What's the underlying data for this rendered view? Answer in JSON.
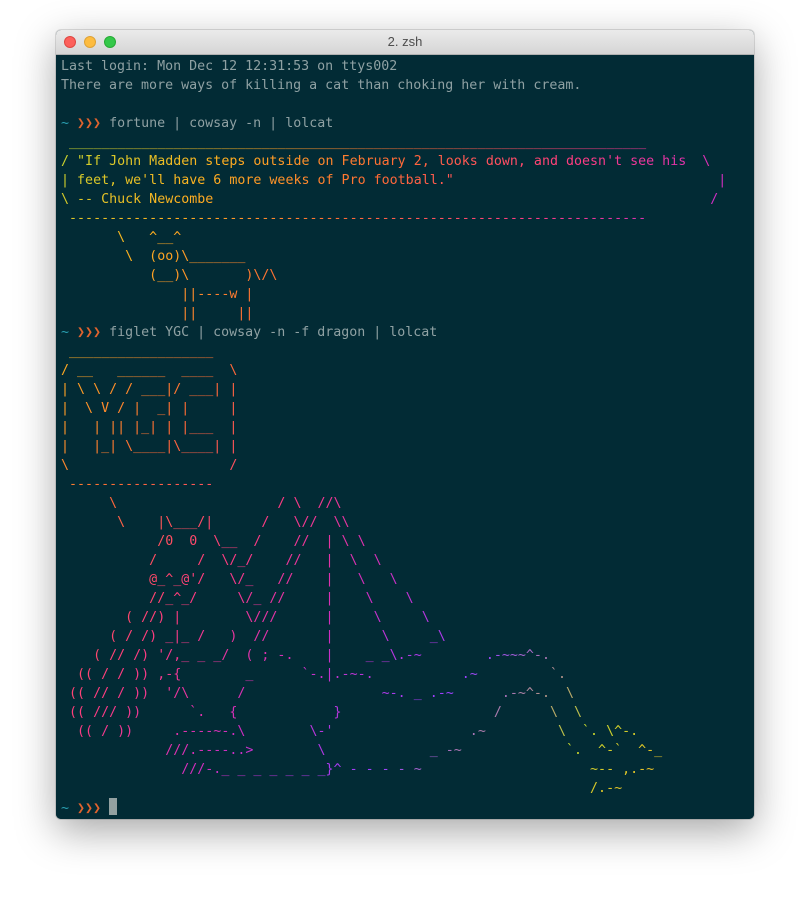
{
  "window": {
    "title": "2. zsh"
  },
  "prompt": {
    "tilde": "~",
    "arrows": "❯❯❯"
  },
  "colors": {
    "background": "#022b35",
    "text": "#8fa1a3",
    "prompt_arrow": "#e0632e",
    "prompt_tilde": "#2aa1b3",
    "lolcat_gradient": [
      "#c5d62e",
      "#ffb020",
      "#ff6b35",
      "#ff3d7f",
      "#d02ec0",
      "#9b40ff"
    ]
  },
  "terminal": {
    "lines": [
      {
        "type": "plain",
        "text": "Last login: Mon Dec 12 12:31:53 on ttys002"
      },
      {
        "type": "plain",
        "text": "There are more ways of killing a cat than choking her with cream."
      },
      {
        "type": "plain",
        "text": ""
      },
      {
        "type": "prompt",
        "text": "fortune | cowsay -n | lolcat"
      },
      {
        "type": "rainbow",
        "text": " ________________________________________________________________________"
      },
      {
        "type": "rainbow",
        "text": "/ \"If John Madden steps outside on February 2, looks down, and doesn't see his  \\"
      },
      {
        "type": "rainbow",
        "text": "| feet, we'll have 6 more weeks of Pro football.\"                                 |"
      },
      {
        "type": "rainbow",
        "text": "\\ -- Chuck Newcombe                                                              /"
      },
      {
        "type": "rainbow",
        "text": " ------------------------------------------------------------------------"
      },
      {
        "type": "rainbow",
        "text": "       \\   ^__^"
      },
      {
        "type": "rainbow",
        "text": "        \\  (oo)\\_______"
      },
      {
        "type": "rainbow",
        "text": "           (__)\\       )\\/\\"
      },
      {
        "type": "rainbow",
        "text": "               ||----w |"
      },
      {
        "type": "rainbow",
        "text": "               ||     ||"
      },
      {
        "type": "prompt",
        "text": "figlet YGC | cowsay -n -f dragon | lolcat"
      },
      {
        "type": "rainbow",
        "text": " __________________"
      },
      {
        "type": "rainbow",
        "text": "/ __   ______  ____  \\"
      },
      {
        "type": "rainbow",
        "text": "| \\ \\ / / ___|/ ___| |"
      },
      {
        "type": "rainbow",
        "text": "|  \\ V / |  _| |     |"
      },
      {
        "type": "rainbow",
        "text": "|   | || |_| | |___  |"
      },
      {
        "type": "rainbow",
        "text": "|   |_| \\____|\\____| |"
      },
      {
        "type": "rainbow",
        "text": "\\                    /"
      },
      {
        "type": "rainbow",
        "text": " ------------------"
      },
      {
        "type": "rainbow",
        "text": "      \\                    / \\  //\\"
      },
      {
        "type": "rainbow",
        "text": "       \\    |\\___/|      /   \\//  \\\\"
      },
      {
        "type": "rainbow",
        "text": "            /0  0  \\__  /    //  | \\ \\"
      },
      {
        "type": "rainbow",
        "text": "           /     /  \\/_/    //   |  \\  \\"
      },
      {
        "type": "rainbow",
        "text": "           @_^_@'/   \\/_   //    |   \\   \\"
      },
      {
        "type": "rainbow",
        "text": "           //_^_/     \\/_ //     |    \\    \\"
      },
      {
        "type": "rainbow",
        "text": "        ( //) |        \\///      |     \\     \\"
      },
      {
        "type": "rainbow",
        "text": "      ( / /) _|_ /   )  //       |      \\     _\\"
      },
      {
        "type": "rainbow",
        "text": "    ( // /) '/,_ _ _/  ( ; -.    |    _ _\\.-~        .-~~~^-."
      },
      {
        "type": "rainbow",
        "text": "  (( / / )) ,-{        _      `-.|.-~-.           .~         `."
      },
      {
        "type": "rainbow",
        "text": " (( // / ))  '/\\      /                 ~-. _ .-~      .-~^-.  \\"
      },
      {
        "type": "rainbow",
        "text": " (( /// ))      `.   {            }                   /      \\  \\"
      },
      {
        "type": "rainbow",
        "text": "  (( / ))     .----~-.\\        \\-'                 .~         \\  `. \\^-."
      },
      {
        "type": "rainbow",
        "text": "             ///.----..>        \\             _ -~             `.  ^-`  ^-_"
      },
      {
        "type": "rainbow",
        "text": "               ///-._ _ _ _ _ _ _}^ - - - - ~                     ~-- ,.-~"
      },
      {
        "type": "rainbow",
        "text": "                                                                  /.-~"
      },
      {
        "type": "cursor",
        "text": ""
      }
    ]
  }
}
